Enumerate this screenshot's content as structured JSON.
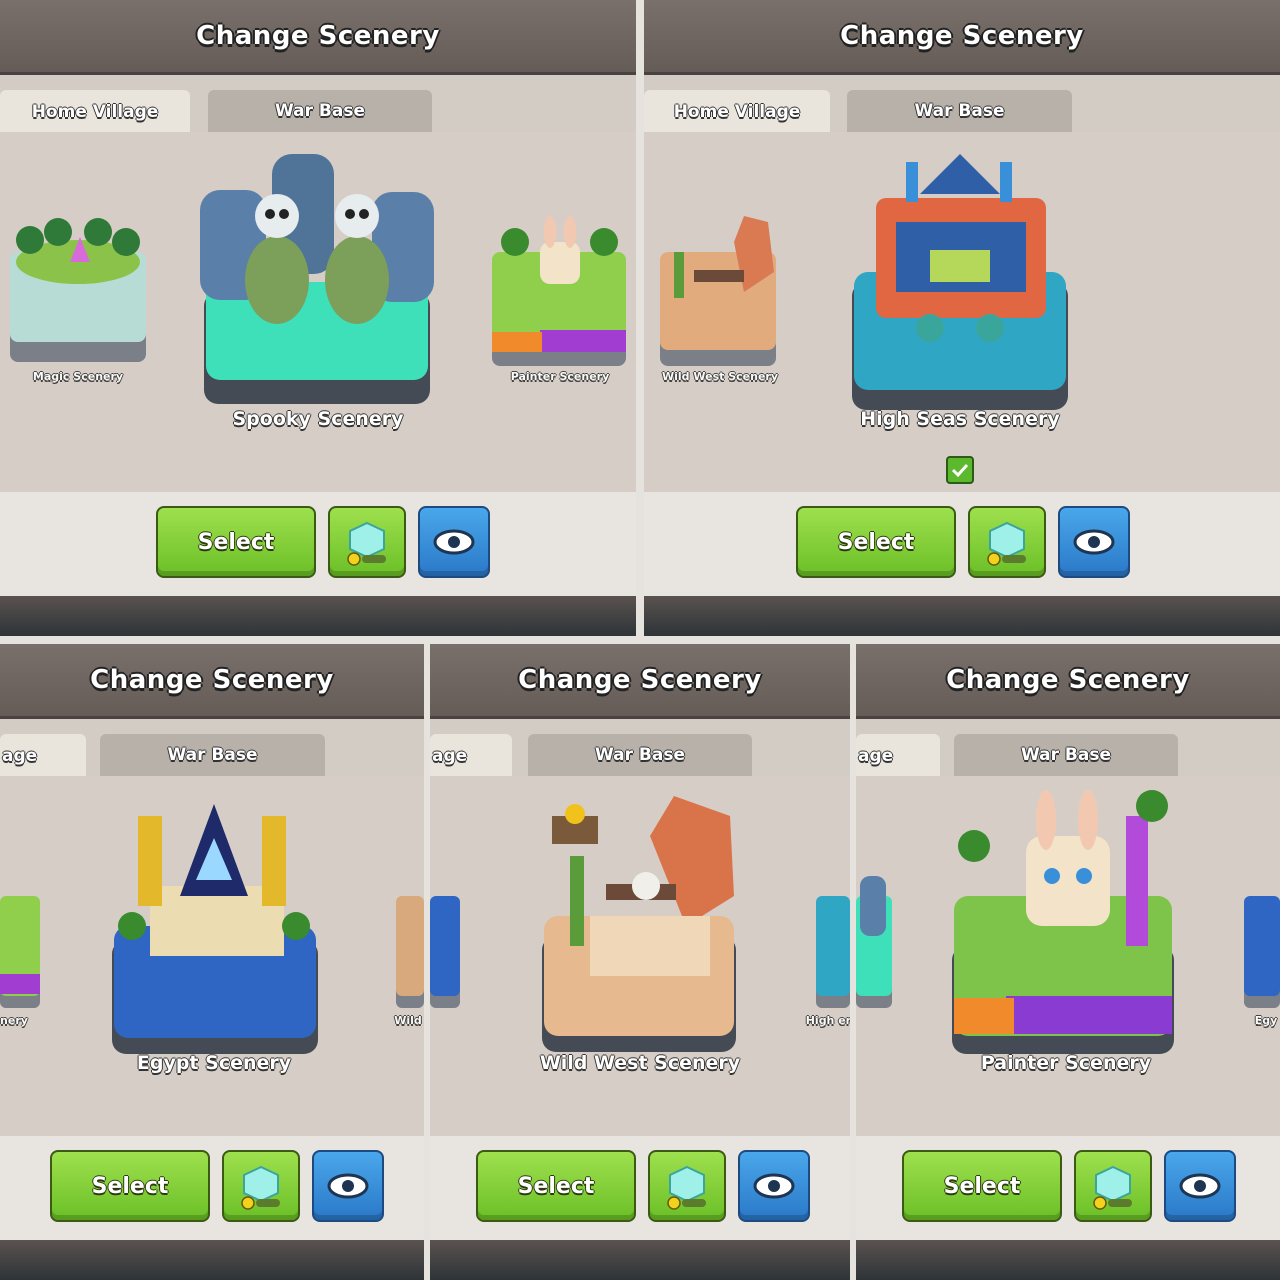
{
  "panels": [
    {
      "title": "Change Scenery",
      "tabs": [
        "Home Village",
        "War Base"
      ],
      "main_scene": "Spooky Scenery",
      "left_scene": "Magic Scenery",
      "right_scene": "Painter Scenery",
      "select_label": "Select"
    },
    {
      "title": "Change Scenery",
      "tabs": [
        "Home Village",
        "War Base"
      ],
      "main_scene": "High Seas Scenery",
      "left_scene": "Wild West Scenery",
      "select_label": "Select"
    },
    {
      "title": "Change Scenery",
      "tabs": [
        "age",
        "War Base"
      ],
      "main_scene": "Egypt Scenery",
      "left_scene": "nery",
      "right_scene": "Wild",
      "select_label": "Select"
    },
    {
      "title": "Change Scenery",
      "tabs": [
        "age",
        "War Base"
      ],
      "main_scene": "Wild West Scenery",
      "right_scene": "High ery",
      "select_label": "Select"
    },
    {
      "title": "Change Scenery",
      "tabs": [
        "age",
        "War Base"
      ],
      "main_scene": "Painter Scenery",
      "right_scene": "Egy",
      "select_label": "Select"
    }
  ],
  "icons": {
    "select_gem": "gem-cube-icon",
    "preview": "eye-icon",
    "selected": "checkmark-icon"
  },
  "colors": {
    "select_green": "#7ccd34",
    "preview_blue": "#3a8fd9",
    "title_bar": "#6e6461"
  }
}
